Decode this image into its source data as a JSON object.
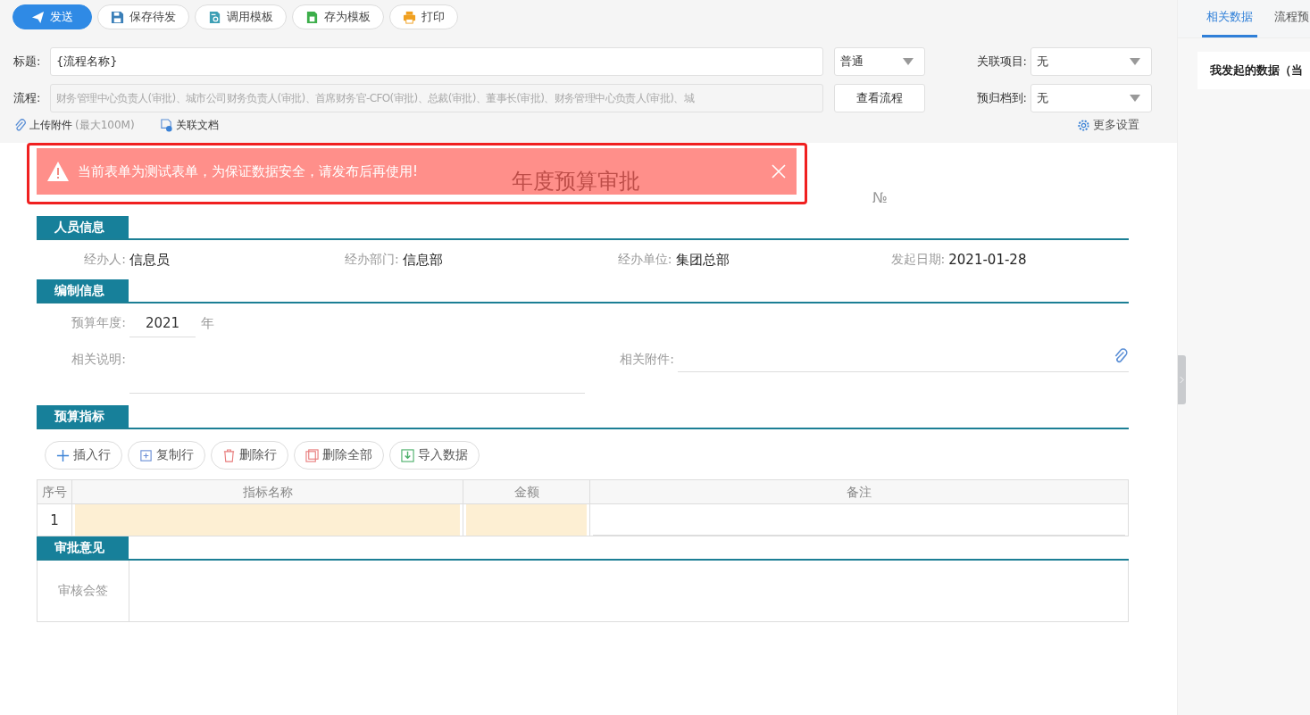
{
  "toolbar": {
    "buttons": [
      {
        "label": "发送",
        "kind": "send"
      },
      {
        "label": "保存待发",
        "kind": "save"
      },
      {
        "label": "调用模板",
        "kind": "template"
      },
      {
        "label": "存为模板",
        "kind": "save_template"
      },
      {
        "label": "打印",
        "kind": "print"
      }
    ]
  },
  "header": {
    "title_label": "标题:",
    "title_value": "{流程名称}",
    "priority": {
      "value": "普通"
    },
    "related_project": {
      "label": "关联项目:",
      "value": "无"
    },
    "flow": {
      "label": "流程:",
      "value": "财务管理中心负责人(审批)、城市公司财务负责人(审批)、首席财务官-CFO(审批)、总裁(审批)、董事长(审批)、财务管理中心负责人(审批)、城"
    },
    "view_flow_button": "查看流程",
    "archive": {
      "label": "预归档到:",
      "value": "无"
    },
    "upload": {
      "label": "上传附件",
      "hint": "(最大100M)"
    },
    "related_docs": "关联文档",
    "more_settings": "更多设置"
  },
  "alert": {
    "message": "当前表单为测试表单，为保证数据安全，请发布后再使用!"
  },
  "form": {
    "title": "年度预算审批",
    "number_sign": "№",
    "personnel": {
      "title": "人员信息",
      "fields": [
        {
          "label": "经办人:",
          "value": "信息员"
        },
        {
          "label": "经办部门:",
          "value": "信息部"
        },
        {
          "label": "经办单位:",
          "value": "集团总部"
        },
        {
          "label": "发起日期:",
          "value": "2021-01-28"
        }
      ]
    },
    "compile": {
      "title": "编制信息",
      "budget_year": {
        "label": "预算年度:",
        "value": "2021",
        "unit": "年"
      },
      "description": {
        "label": "相关说明:"
      },
      "attachment": {
        "label": "相关附件:"
      }
    },
    "indicators": {
      "title": "预算指标",
      "row_buttons": [
        {
          "label": "插入行",
          "kind": "insert"
        },
        {
          "label": "复制行",
          "kind": "copy"
        },
        {
          "label": "删除行",
          "kind": "delete"
        },
        {
          "label": "删除全部",
          "kind": "delete_all"
        },
        {
          "label": "导入数据",
          "kind": "import"
        }
      ],
      "columns": [
        {
          "label": "序号",
          "kind": "index"
        },
        {
          "label": "指标名称",
          "kind": "input",
          "required": true
        },
        {
          "label": "金额",
          "kind": "input",
          "required": true
        },
        {
          "label": "备注",
          "kind": "input",
          "required": false
        }
      ],
      "rows": [
        {
          "index": "1"
        }
      ]
    },
    "approval": {
      "title": "审批意见",
      "label": "审核会签"
    }
  },
  "side_panel": {
    "tabs": [
      {
        "label": "相关数据",
        "selected": true
      },
      {
        "label": "流程预",
        "selected": false
      }
    ],
    "card_title": "我发起的数据（当"
  }
}
